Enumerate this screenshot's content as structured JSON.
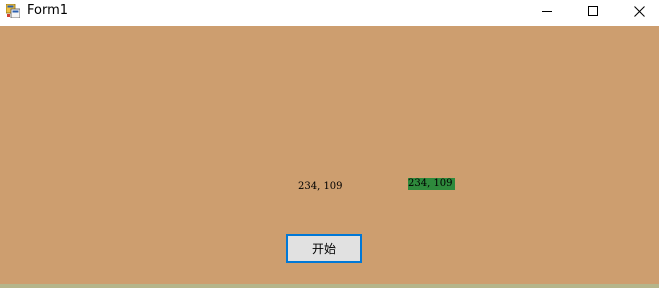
{
  "window": {
    "title": "Form1",
    "icon": "winforms-app-icon",
    "controls": {
      "minimize_icon": "minimize-icon",
      "maximize_icon": "maximize-icon",
      "close_icon": "close-icon"
    }
  },
  "client": {
    "background": "#cd9e6f",
    "label_plain": "234, 109",
    "label_green": "234, 109",
    "label_green_bg": "#2e8a3c",
    "start_button": "开始",
    "start_button_border": "#0078d7"
  }
}
